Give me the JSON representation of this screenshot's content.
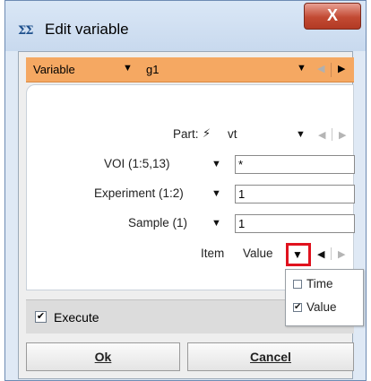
{
  "window": {
    "title": "Edit variable",
    "icon_text": "ΣΣ",
    "close_glyph": "X"
  },
  "variable_bar": {
    "label": "Variable",
    "value": "g1",
    "dropdown_glyph": "▼",
    "prev_glyph": "◀",
    "next_glyph": "▶",
    "bar_color": "#f5a862"
  },
  "form": {
    "part": {
      "label": "Part:",
      "icon_glyph": "⚡",
      "value": "vt",
      "dropdown_glyph": "▼"
    },
    "voi": {
      "label": "VOI (1:5,13)",
      "value": "*",
      "dropdown_glyph": "▼"
    },
    "experiment": {
      "label": "Experiment (1:2)",
      "value": "1",
      "dropdown_glyph": "▼"
    },
    "sample": {
      "label": "Sample (1)",
      "value": "1",
      "dropdown_glyph": "▼"
    },
    "item": {
      "label": "Item",
      "value": "Value",
      "dropdown_glyph": "▼"
    },
    "nav_prev_glyph": "◀",
    "nav_next_glyph": "▶"
  },
  "item_popup": {
    "options": [
      {
        "label": "Time",
        "checked": false
      },
      {
        "label": "Value",
        "checked": true
      }
    ],
    "check_glyph": "✔"
  },
  "execute": {
    "label": "Execute",
    "checked": true,
    "check_glyph": "✔"
  },
  "buttons": {
    "ok_label": "Ok",
    "cancel_label": "Cancel"
  },
  "colors": {
    "highlight": "#e0121e"
  }
}
